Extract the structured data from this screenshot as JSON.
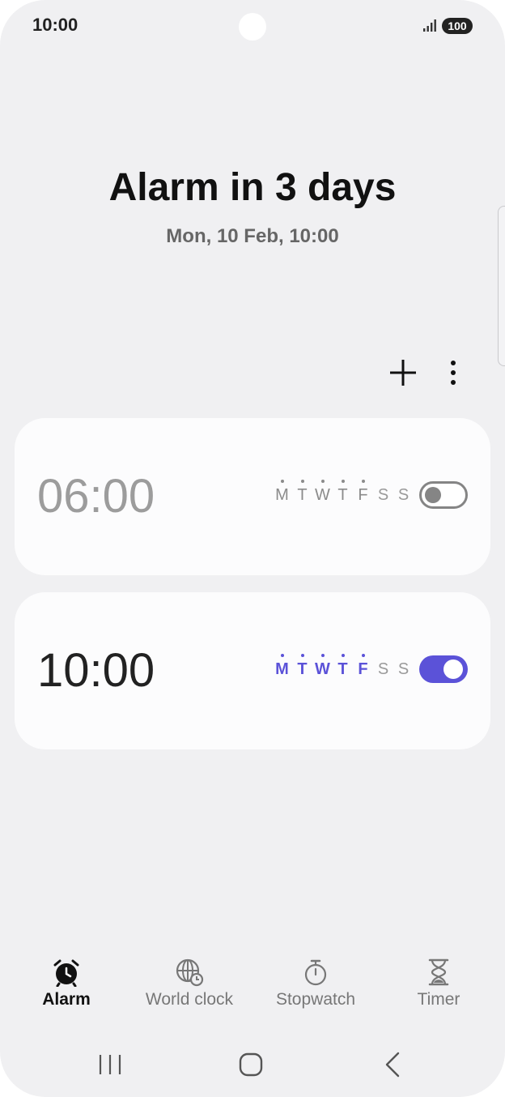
{
  "status_bar": {
    "time": "10:00",
    "battery": "100"
  },
  "header": {
    "title": "Alarm in 3 days",
    "subtitle": "Mon, 10 Feb, 10:00"
  },
  "alarms": [
    {
      "time": "06:00",
      "enabled": false,
      "days": [
        {
          "label": "M",
          "selected": true
        },
        {
          "label": "T",
          "selected": true
        },
        {
          "label": "W",
          "selected": true
        },
        {
          "label": "T",
          "selected": true
        },
        {
          "label": "F",
          "selected": true
        },
        {
          "label": "S",
          "selected": false
        },
        {
          "label": "S",
          "selected": false
        }
      ]
    },
    {
      "time": "10:00",
      "enabled": true,
      "days": [
        {
          "label": "M",
          "selected": true
        },
        {
          "label": "T",
          "selected": true
        },
        {
          "label": "W",
          "selected": true
        },
        {
          "label": "T",
          "selected": true
        },
        {
          "label": "F",
          "selected": true
        },
        {
          "label": "S",
          "selected": false
        },
        {
          "label": "S",
          "selected": false
        }
      ]
    }
  ],
  "tabs": [
    {
      "label": "Alarm",
      "icon": "alarm-clock-icon",
      "active": true
    },
    {
      "label": "World clock",
      "icon": "globe-clock-icon",
      "active": false
    },
    {
      "label": "Stopwatch",
      "icon": "stopwatch-icon",
      "active": false
    },
    {
      "label": "Timer",
      "icon": "hourglass-icon",
      "active": false
    }
  ],
  "colors": {
    "accent": "#5b52d8",
    "background": "#f0f0f2",
    "card": "#fcfcfd"
  }
}
